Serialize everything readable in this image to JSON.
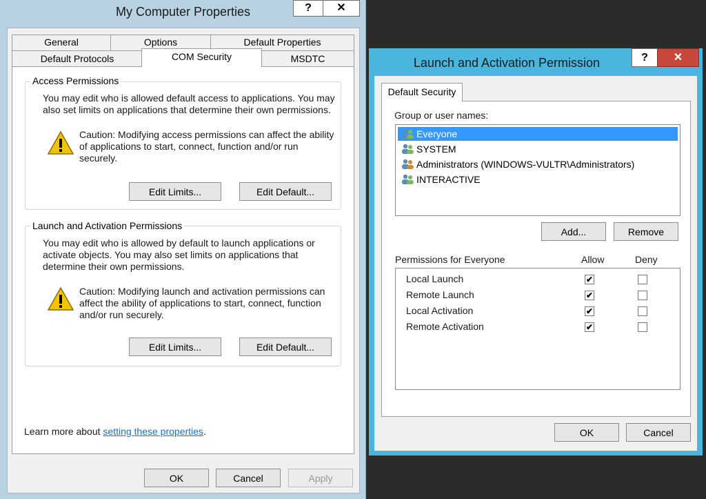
{
  "dialog1": {
    "title": "My Computer Properties",
    "help_label": "?",
    "close_label": "✕",
    "tabs": {
      "general": "General",
      "options": "Options",
      "default_properties": "Default Properties",
      "default_protocols": "Default Protocols",
      "com_security": "COM Security",
      "msdtc": "MSDTC"
    },
    "access": {
      "title": "Access Permissions",
      "desc_1": "You may edit who is allowed default access to applications. You may",
      "desc_2": "also set limits on applications that determine their own permissions.",
      "caution_1": "Caution: Modifying access permissions can affect the ability",
      "caution_2": "of applications to start, connect, function and/or run",
      "caution_3": "securely.",
      "edit_limits": "Edit Limits...",
      "edit_default": "Edit Default..."
    },
    "launch": {
      "title": "Launch and Activation Permissions",
      "desc_1": "You may edit who is allowed by default to launch applications or",
      "desc_2": "activate objects. You may also set limits on applications that",
      "desc_3": "determine their own permissions.",
      "caution_1": "Caution: Modifying launch and activation permissions can",
      "caution_2": "affect the ability of applications to start, connect, function",
      "caution_3": "and/or run securely.",
      "edit_limits": "Edit Limits...",
      "edit_default": "Edit Default..."
    },
    "learn_more_prefix": "Learn more about ",
    "learn_more_link": "setting these properties",
    "learn_more_suffix": ".",
    "ok": "OK",
    "cancel": "Cancel",
    "apply": "Apply"
  },
  "dialog2": {
    "title": "Launch and Activation Permission",
    "help_label": "?",
    "close_label": "✕",
    "tab": "Default Security",
    "group_label": "Group or user names:",
    "users": [
      {
        "name": "Everyone",
        "selected": true
      },
      {
        "name": "SYSTEM",
        "selected": false
      },
      {
        "name": "Administrators (WINDOWS-VULTR\\Administrators)",
        "selected": false
      },
      {
        "name": "INTERACTIVE",
        "selected": false
      }
    ],
    "add": "Add...",
    "remove": "Remove",
    "permissions_label": "Permissions for Everyone",
    "allow_header": "Allow",
    "deny_header": "Deny",
    "permissions": [
      {
        "name": "Local Launch",
        "allow": true,
        "deny": false
      },
      {
        "name": "Remote Launch",
        "allow": true,
        "deny": false
      },
      {
        "name": "Local Activation",
        "allow": true,
        "deny": false
      },
      {
        "name": "Remote Activation",
        "allow": true,
        "deny": false
      }
    ],
    "check_glyph": "✔",
    "ok": "OK",
    "cancel": "Cancel"
  },
  "colors": {
    "accent_blue": "#4ab6dd",
    "selection": "#3399ff",
    "close_red": "#c9483c",
    "link": "#1a6fc9"
  }
}
